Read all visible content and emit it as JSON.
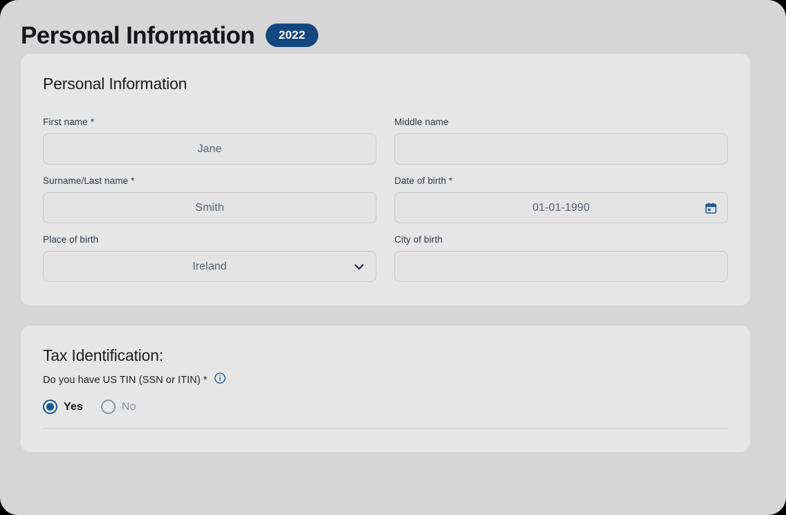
{
  "header": {
    "title": "Personal Information",
    "year_badge": "2022",
    "badge_color": "#14477d"
  },
  "personal_card": {
    "heading": "Personal Information",
    "fields": [
      {
        "label": "First name",
        "required": true,
        "value": "Jane",
        "placeholder": "",
        "type": "text"
      },
      {
        "label": "Middle name",
        "required": false,
        "value": "",
        "placeholder": "",
        "type": "text"
      },
      {
        "label": "Surname/Last name",
        "required": true,
        "value": "Smith",
        "placeholder": "",
        "type": "text"
      },
      {
        "label": "Date of birth",
        "required": true,
        "value": "01-01-1990",
        "placeholder": "",
        "type": "date",
        "icon": "calendar-icon"
      },
      {
        "label": "Place of birth",
        "required": false,
        "value": "Ireland",
        "placeholder": "",
        "type": "select",
        "icon": "chevron-down-icon"
      },
      {
        "label": "City of birth",
        "required": false,
        "value": "",
        "placeholder": "",
        "type": "text"
      }
    ]
  },
  "tax_card": {
    "heading": "Tax Identification:",
    "question": "Do you have US TIN (SSN or ITIN) *",
    "info_icon": "info-icon",
    "options": [
      {
        "label": "Yes",
        "selected": true
      },
      {
        "label": "No",
        "selected": false
      }
    ]
  },
  "colors": {
    "page_background": "#d6d6d6",
    "card_background": "#e6e6e6",
    "accent_blue": "#14477d",
    "radio_blue": "#19568f",
    "input_text": "#56616f",
    "label_text": "#2c3744"
  },
  "required_marker": "*"
}
